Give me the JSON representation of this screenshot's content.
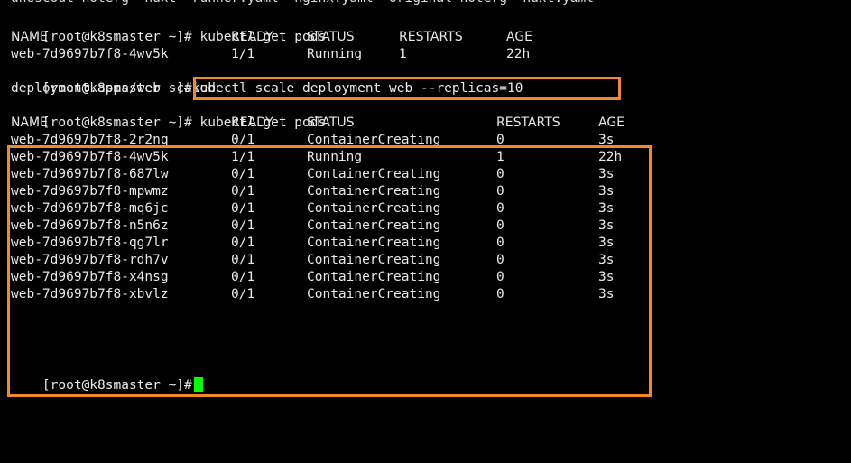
{
  "top_cut_line": "unescoul-noterg  nuxt  runner.yaml  nginx.yaml  original-noterg  nuxt.yaml",
  "prompt": "[root@k8smaster ~]#",
  "cmd1": "kubectl get pods",
  "table1": {
    "headers": [
      "NAME",
      "READY",
      "STATUS",
      "RESTARTS",
      "AGE"
    ],
    "rows": [
      [
        "web-7d9697b7f8-4wv5k",
        "1/1",
        "Running",
        "1",
        "22h"
      ]
    ]
  },
  "cmd2": "kubectl scale deployment web --replicas=10",
  "scale_output": "deployment.apps/web scaled",
  "cmd3": "kubectl get pods",
  "table2": {
    "headers": [
      "NAME",
      "READY",
      "STATUS",
      "RESTARTS",
      "AGE"
    ],
    "rows": [
      [
        "web-7d9697b7f8-2r2nq",
        "0/1",
        "ContainerCreating",
        "0",
        "3s"
      ],
      [
        "web-7d9697b7f8-4wv5k",
        "1/1",
        "Running",
        "1",
        "22h"
      ],
      [
        "web-7d9697b7f8-687lw",
        "0/1",
        "ContainerCreating",
        "0",
        "3s"
      ],
      [
        "web-7d9697b7f8-mpwmz",
        "0/1",
        "ContainerCreating",
        "0",
        "3s"
      ],
      [
        "web-7d9697b7f8-mq6jc",
        "0/1",
        "ContainerCreating",
        "0",
        "3s"
      ],
      [
        "web-7d9697b7f8-n5n6z",
        "0/1",
        "ContainerCreating",
        "0",
        "3s"
      ],
      [
        "web-7d9697b7f8-qg7lr",
        "0/1",
        "ContainerCreating",
        "0",
        "3s"
      ],
      [
        "web-7d9697b7f8-rdh7v",
        "0/1",
        "ContainerCreating",
        "0",
        "3s"
      ],
      [
        "web-7d9697b7f8-x4nsg",
        "0/1",
        "ContainerCreating",
        "0",
        "3s"
      ],
      [
        "web-7d9697b7f8-xbvlz",
        "0/1",
        "ContainerCreating",
        "0",
        "3s"
      ]
    ]
  },
  "colors": {
    "background": "#000000",
    "text": "#e8e8e8",
    "highlight": "#f08a2a",
    "cursor": "#00ff00"
  }
}
